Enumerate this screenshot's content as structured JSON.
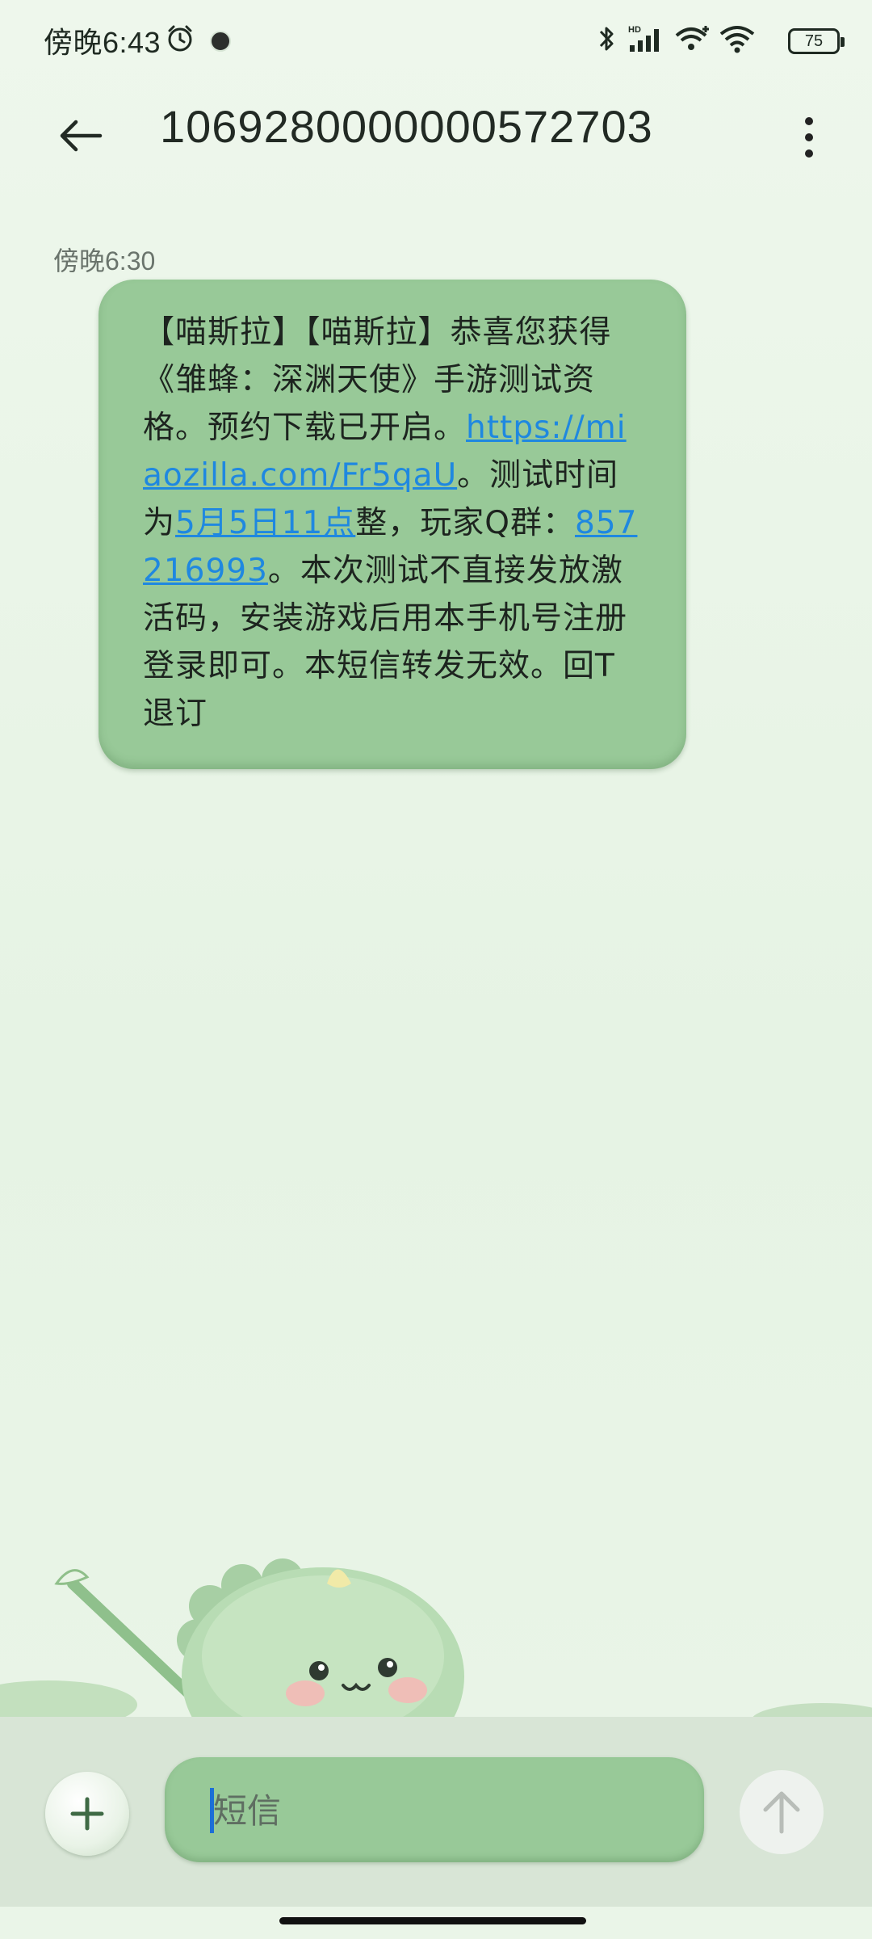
{
  "status_bar": {
    "time": "傍晚6:43",
    "battery": "75",
    "icons": [
      "alarm-icon",
      "notification-dot-icon",
      "bluetooth-icon",
      "hd-signal-icon",
      "wifi-plus-icon",
      "wifi-icon",
      "battery-icon"
    ]
  },
  "header": {
    "title": "1069280000000572703",
    "back_icon": "back-arrow-icon",
    "more_icon": "more-vertical-icon"
  },
  "message": {
    "time": "傍晚6:30",
    "segments": [
      {
        "type": "text",
        "text": "【喵斯拉】【喵斯拉】恭喜您获得《雏蜂：深渊天使》手游测试资格。预约下载已开启。"
      },
      {
        "type": "link",
        "text": "https://miaozilla.com/Fr5qaU"
      },
      {
        "type": "text",
        "text": "。测试时间为"
      },
      {
        "type": "link",
        "text": "5月5日11点"
      },
      {
        "type": "text",
        "text": "整，玩家Q群："
      },
      {
        "type": "link",
        "text": "857216993"
      },
      {
        "type": "text",
        "text": "。本次测试不直接发放激活码，安装游戏后用本手机号注册登录即可。本短信转发无效。回T退订"
      }
    ]
  },
  "composer": {
    "placeholder": "短信",
    "value": "",
    "add_icon": "plus-icon",
    "send_icon": "send-arrow-icon"
  },
  "colors": {
    "bubble": "#98c998",
    "link": "#1f88e0",
    "background": "#e9f4e7"
  }
}
